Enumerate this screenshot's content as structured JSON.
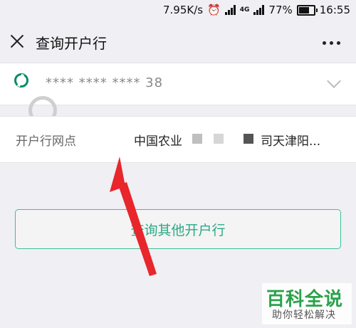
{
  "status_bar": {
    "speed": "7.95K/s",
    "net_tag": "4G",
    "battery": "77%",
    "time": "16:55"
  },
  "title_bar": {
    "title": "查询开户行"
  },
  "card": {
    "number": "**** **** **** 38"
  },
  "branch": {
    "label": "开户行网点",
    "value_prefix": "中国农业",
    "value_suffix": "司天津阳..."
  },
  "query_button": {
    "label": "查询其他开户行"
  },
  "watermark": {
    "title": "百科全说",
    "subtitle": "助你轻松解决"
  },
  "colors": {
    "accent": "#2aaa86",
    "annotation": "#e8262b"
  }
}
